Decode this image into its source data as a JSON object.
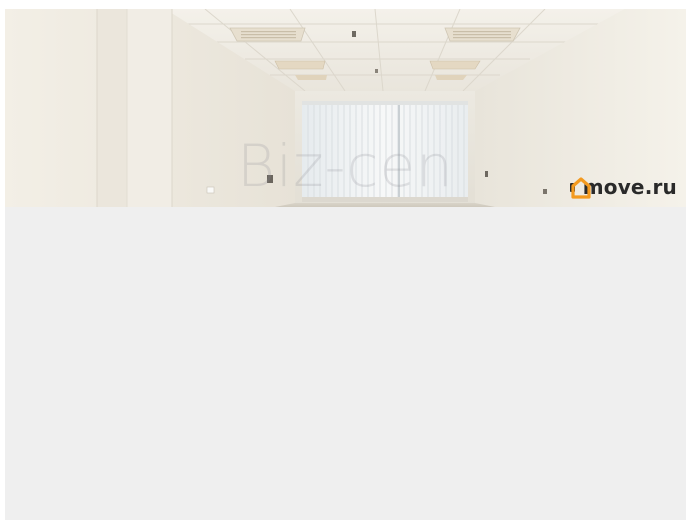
{
  "photo": {
    "watermark_text": "Biz-cen",
    "brand": {
      "name": "move.ru",
      "logo_icon": "house-icon",
      "logo_color": "#f39a1f"
    }
  },
  "colors": {
    "page_background": "#ffffff",
    "frame_background": "#efefef",
    "wall": "#f2efe8",
    "ceiling": "#f5f3ee"
  }
}
